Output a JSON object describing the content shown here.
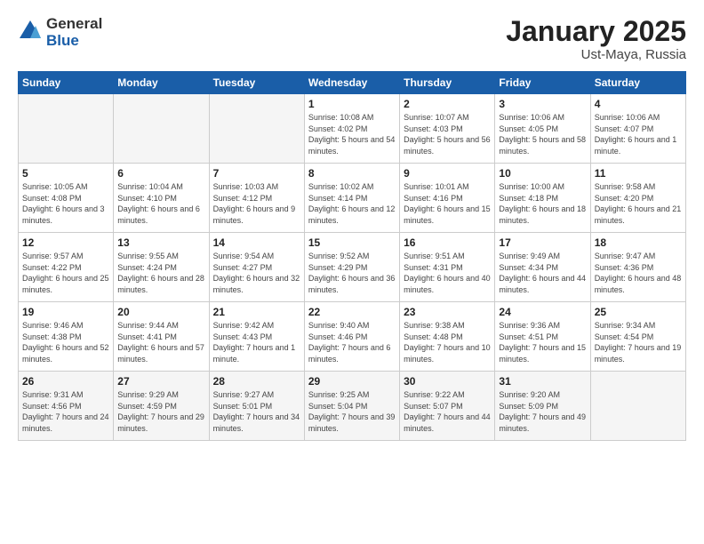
{
  "logo": {
    "general": "General",
    "blue": "Blue"
  },
  "title": {
    "month": "January 2025",
    "location": "Ust-Maya, Russia"
  },
  "days_of_week": [
    "Sunday",
    "Monday",
    "Tuesday",
    "Wednesday",
    "Thursday",
    "Friday",
    "Saturday"
  ],
  "weeks": [
    [
      {
        "day": "",
        "info": ""
      },
      {
        "day": "",
        "info": ""
      },
      {
        "day": "",
        "info": ""
      },
      {
        "day": "1",
        "info": "Sunrise: 10:08 AM\nSunset: 4:02 PM\nDaylight: 5 hours\nand 54 minutes."
      },
      {
        "day": "2",
        "info": "Sunrise: 10:07 AM\nSunset: 4:03 PM\nDaylight: 5 hours\nand 56 minutes."
      },
      {
        "day": "3",
        "info": "Sunrise: 10:06 AM\nSunset: 4:05 PM\nDaylight: 5 hours\nand 58 minutes."
      },
      {
        "day": "4",
        "info": "Sunrise: 10:06 AM\nSunset: 4:07 PM\nDaylight: 6 hours\nand 1 minute."
      }
    ],
    [
      {
        "day": "5",
        "info": "Sunrise: 10:05 AM\nSunset: 4:08 PM\nDaylight: 6 hours\nand 3 minutes."
      },
      {
        "day": "6",
        "info": "Sunrise: 10:04 AM\nSunset: 4:10 PM\nDaylight: 6 hours\nand 6 minutes."
      },
      {
        "day": "7",
        "info": "Sunrise: 10:03 AM\nSunset: 4:12 PM\nDaylight: 6 hours\nand 9 minutes."
      },
      {
        "day": "8",
        "info": "Sunrise: 10:02 AM\nSunset: 4:14 PM\nDaylight: 6 hours\nand 12 minutes."
      },
      {
        "day": "9",
        "info": "Sunrise: 10:01 AM\nSunset: 4:16 PM\nDaylight: 6 hours\nand 15 minutes."
      },
      {
        "day": "10",
        "info": "Sunrise: 10:00 AM\nSunset: 4:18 PM\nDaylight: 6 hours\nand 18 minutes."
      },
      {
        "day": "11",
        "info": "Sunrise: 9:58 AM\nSunset: 4:20 PM\nDaylight: 6 hours\nand 21 minutes."
      }
    ],
    [
      {
        "day": "12",
        "info": "Sunrise: 9:57 AM\nSunset: 4:22 PM\nDaylight: 6 hours\nand 25 minutes."
      },
      {
        "day": "13",
        "info": "Sunrise: 9:55 AM\nSunset: 4:24 PM\nDaylight: 6 hours\nand 28 minutes."
      },
      {
        "day": "14",
        "info": "Sunrise: 9:54 AM\nSunset: 4:27 PM\nDaylight: 6 hours\nand 32 minutes."
      },
      {
        "day": "15",
        "info": "Sunrise: 9:52 AM\nSunset: 4:29 PM\nDaylight: 6 hours\nand 36 minutes."
      },
      {
        "day": "16",
        "info": "Sunrise: 9:51 AM\nSunset: 4:31 PM\nDaylight: 6 hours\nand 40 minutes."
      },
      {
        "day": "17",
        "info": "Sunrise: 9:49 AM\nSunset: 4:34 PM\nDaylight: 6 hours\nand 44 minutes."
      },
      {
        "day": "18",
        "info": "Sunrise: 9:47 AM\nSunset: 4:36 PM\nDaylight: 6 hours\nand 48 minutes."
      }
    ],
    [
      {
        "day": "19",
        "info": "Sunrise: 9:46 AM\nSunset: 4:38 PM\nDaylight: 6 hours\nand 52 minutes."
      },
      {
        "day": "20",
        "info": "Sunrise: 9:44 AM\nSunset: 4:41 PM\nDaylight: 6 hours\nand 57 minutes."
      },
      {
        "day": "21",
        "info": "Sunrise: 9:42 AM\nSunset: 4:43 PM\nDaylight: 7 hours\nand 1 minute."
      },
      {
        "day": "22",
        "info": "Sunrise: 9:40 AM\nSunset: 4:46 PM\nDaylight: 7 hours\nand 6 minutes."
      },
      {
        "day": "23",
        "info": "Sunrise: 9:38 AM\nSunset: 4:48 PM\nDaylight: 7 hours\nand 10 minutes."
      },
      {
        "day": "24",
        "info": "Sunrise: 9:36 AM\nSunset: 4:51 PM\nDaylight: 7 hours\nand 15 minutes."
      },
      {
        "day": "25",
        "info": "Sunrise: 9:34 AM\nSunset: 4:54 PM\nDaylight: 7 hours\nand 19 minutes."
      }
    ],
    [
      {
        "day": "26",
        "info": "Sunrise: 9:31 AM\nSunset: 4:56 PM\nDaylight: 7 hours\nand 24 minutes."
      },
      {
        "day": "27",
        "info": "Sunrise: 9:29 AM\nSunset: 4:59 PM\nDaylight: 7 hours\nand 29 minutes."
      },
      {
        "day": "28",
        "info": "Sunrise: 9:27 AM\nSunset: 5:01 PM\nDaylight: 7 hours\nand 34 minutes."
      },
      {
        "day": "29",
        "info": "Sunrise: 9:25 AM\nSunset: 5:04 PM\nDaylight: 7 hours\nand 39 minutes."
      },
      {
        "day": "30",
        "info": "Sunrise: 9:22 AM\nSunset: 5:07 PM\nDaylight: 7 hours\nand 44 minutes."
      },
      {
        "day": "31",
        "info": "Sunrise: 9:20 AM\nSunset: 5:09 PM\nDaylight: 7 hours\nand 49 minutes."
      },
      {
        "day": "",
        "info": ""
      }
    ]
  ]
}
